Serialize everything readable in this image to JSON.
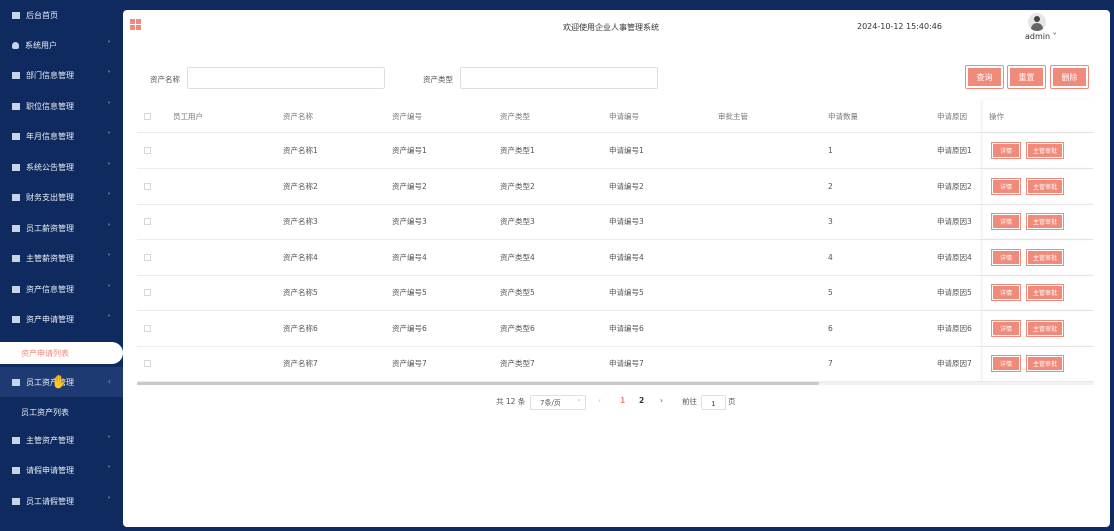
{
  "sidebar": {
    "items": [
      {
        "label": "后台首页",
        "icon": "home-icon"
      },
      {
        "label": "系统用户",
        "icon": "user-icon"
      },
      {
        "label": "部门信息管理",
        "icon": "list-icon"
      },
      {
        "label": "职位信息管理",
        "icon": "list-icon"
      },
      {
        "label": "年月信息管理",
        "icon": "list-icon"
      },
      {
        "label": "系统公告管理",
        "icon": "list-icon"
      },
      {
        "label": "财务支出管理",
        "icon": "list-icon"
      },
      {
        "label": "员工薪资管理",
        "icon": "list-icon"
      },
      {
        "label": "主管薪资管理",
        "icon": "list-icon"
      },
      {
        "label": "资产信息管理",
        "icon": "list-icon"
      },
      {
        "label": "资产申请管理",
        "icon": "list-icon"
      },
      {
        "label": "员工资产管理",
        "icon": "list-icon"
      },
      {
        "label": "主管资产管理",
        "icon": "list-icon"
      },
      {
        "label": "请假申请管理",
        "icon": "list-icon"
      },
      {
        "label": "员工请假管理",
        "icon": "list-icon"
      }
    ],
    "sub_active": "资产申请列表",
    "sub_second": "员工资产列表"
  },
  "header": {
    "welcome": "欢迎使用企业人事管理系统",
    "datetime": "2024-10-12 15:40:46",
    "user": "admin"
  },
  "search": {
    "asset_name_label": "资产名称",
    "asset_name_value": "",
    "asset_type_label": "资产类型",
    "asset_type_value": "",
    "query_btn": "查询",
    "reset_btn": "重置",
    "delete_btn": "删除"
  },
  "table": {
    "headers": [
      "员工用户",
      "资产名称",
      "资产编号",
      "资产类型",
      "申请编号",
      "审批主管",
      "申请数量",
      "申请原因",
      "操作"
    ],
    "rows": [
      [
        "",
        "资产名称1",
        "资产编号1",
        "资产类型1",
        "申请编号1",
        "",
        "1",
        "申请原因1"
      ],
      [
        "",
        "资产名称2",
        "资产编号2",
        "资产类型2",
        "申请编号2",
        "",
        "2",
        "申请原因2"
      ],
      [
        "",
        "资产名称3",
        "资产编号3",
        "资产类型3",
        "申请编号3",
        "",
        "3",
        "申请原因3"
      ],
      [
        "",
        "资产名称4",
        "资产编号4",
        "资产类型4",
        "申请编号4",
        "",
        "4",
        "申请原因4"
      ],
      [
        "",
        "资产名称5",
        "资产编号5",
        "资产类型5",
        "申请编号5",
        "",
        "5",
        "申请原因5"
      ],
      [
        "",
        "资产名称6",
        "资产编号6",
        "资产类型6",
        "申请编号6",
        "",
        "6",
        "申请原因6"
      ],
      [
        "",
        "资产名称7",
        "资产编号7",
        "资产类型7",
        "申请编号7",
        "",
        "7",
        "申请原因7"
      ]
    ],
    "detail_btn": "详情",
    "approve_btn": "主管审批"
  },
  "pagination": {
    "total": "共 12 条",
    "page_size": "7条/页",
    "pages": [
      "1",
      "2"
    ],
    "current_page": "1",
    "goto_label": "前往",
    "goto_value": "1",
    "page_suffix": "页"
  },
  "colors": {
    "accent": "#f08a7a",
    "sidebar_bg": "#0e2a5e"
  }
}
